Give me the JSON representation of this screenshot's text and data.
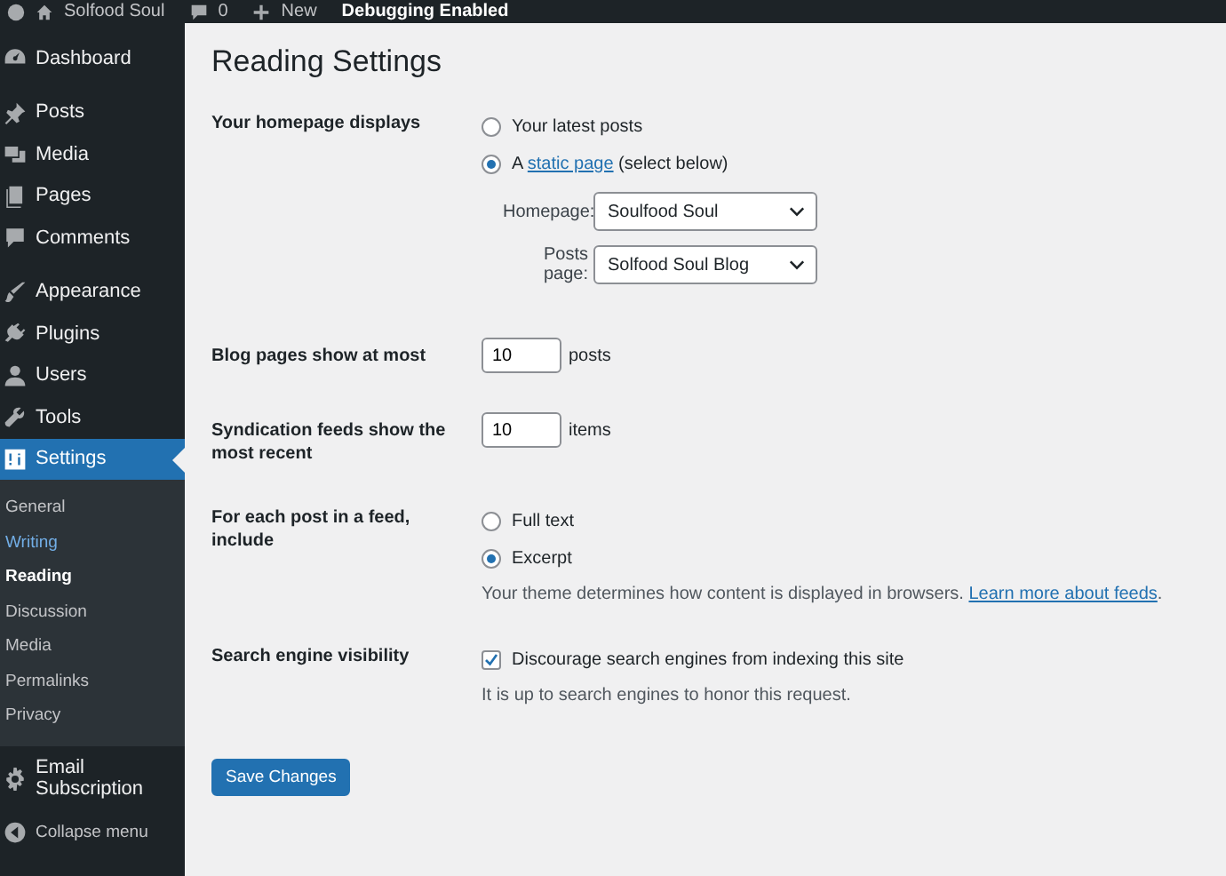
{
  "admin_bar": {
    "site_name": "Solfood Soul",
    "comments_count": "0",
    "new_label": "New",
    "notice": "Debugging Enabled"
  },
  "sidebar": {
    "groups": [
      [
        {
          "label": "Dashboard",
          "selected": false
        }
      ],
      [
        {
          "label": "Posts",
          "selected": false
        },
        {
          "label": "Media",
          "selected": false
        },
        {
          "label": "Pages",
          "selected": false
        },
        {
          "label": "Comments",
          "selected": false
        }
      ],
      [
        {
          "label": "Appearance",
          "selected": false
        },
        {
          "label": "Plugins",
          "selected": false
        },
        {
          "label": "Users",
          "selected": false
        },
        {
          "label": "Tools",
          "selected": false
        },
        {
          "label": "Settings",
          "selected": true,
          "children": [
            {
              "label": "General",
              "selected": false,
              "hovered": false
            },
            {
              "label": "Writing",
              "selected": false,
              "hovered": true
            },
            {
              "label": "Reading",
              "selected": true,
              "hovered": false
            },
            {
              "label": "Discussion",
              "selected": false,
              "hovered": false
            },
            {
              "label": "Media",
              "selected": false,
              "hovered": false
            },
            {
              "label": "Permalinks",
              "selected": false,
              "hovered": false
            },
            {
              "label": "Privacy",
              "selected": false,
              "hovered": false
            }
          ]
        }
      ],
      [
        {
          "label": "Email Subscription",
          "selected": false
        }
      ]
    ],
    "collapse": "Collapse menu"
  },
  "page_title": "Reading Settings",
  "rows": [
    {
      "kind": "radios",
      "label": "Your homepage displays",
      "options": [
        {
          "before": "Your latest posts",
          "selected": false
        },
        {
          "before": "A ",
          "link": "static page",
          "after": " (select below)",
          "selected": true
        }
      ],
      "selects": [
        {
          "label": "Homepage:",
          "value": "Soulfood Soul"
        },
        {
          "label": "Posts page:",
          "value": "Solfood Soul Blog"
        }
      ]
    },
    {
      "kind": "number",
      "label": "Blog pages show at most",
      "value": "10",
      "unit": "posts"
    },
    {
      "kind": "number",
      "label": "Syndication feeds show the most recent",
      "value": "10",
      "unit": "items"
    },
    {
      "kind": "radios",
      "label": "For each post in a feed, include",
      "options": [
        {
          "before": "Full text",
          "selected": false
        },
        {
          "before": "Excerpt",
          "selected": true
        }
      ],
      "description": {
        "text": "Your theme determines how content is displayed in browsers. ",
        "link": "Learn more about feeds",
        "after": "."
      }
    },
    {
      "kind": "checkbox",
      "label": "Search engine visibility",
      "checkbox": {
        "label": "Discourage search engines from indexing this site",
        "checked": true
      },
      "description": {
        "text": "It is up to search engines to honor this request."
      }
    }
  ],
  "save_button": "Save Changes"
}
